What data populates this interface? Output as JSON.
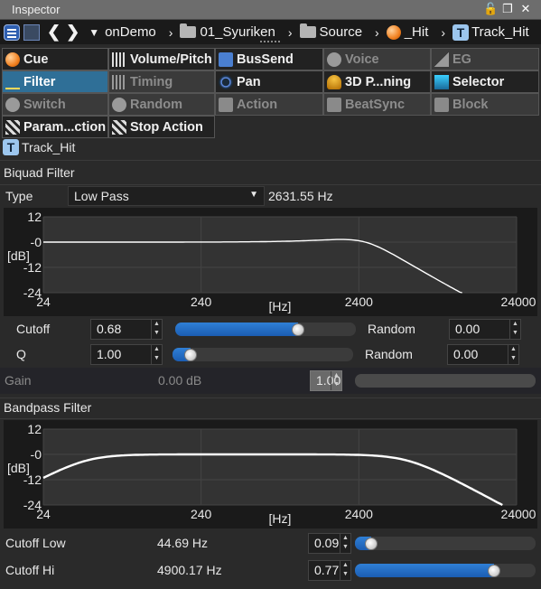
{
  "window": {
    "title": "Inspector"
  },
  "breadcrumb": [
    {
      "label": "onDemo",
      "icon": "dropdown-arrow"
    },
    {
      "label": "01_Syuriken",
      "icon": "folder-icon"
    },
    {
      "label": "Source",
      "icon": "folder-icon"
    },
    {
      "label": "_Hit",
      "icon": "cue-orb-icon"
    },
    {
      "label": "Track_Hit",
      "icon": "track-icon"
    }
  ],
  "modules": [
    {
      "label": "Cue",
      "icon": "cue-orb-icon",
      "enabled": true,
      "selected": false
    },
    {
      "label": "Volume/Pitch",
      "icon": "volume-pitch-icon",
      "enabled": true,
      "selected": false
    },
    {
      "label": "BusSend",
      "icon": "bussend-icon",
      "enabled": true,
      "selected": false
    },
    {
      "label": "Voice",
      "icon": "voice-icon",
      "enabled": false,
      "selected": false
    },
    {
      "label": "EG",
      "icon": "eg-icon",
      "enabled": false,
      "selected": false
    },
    {
      "label": "Filter",
      "icon": "filter-icon",
      "enabled": true,
      "selected": true
    },
    {
      "label": "Timing",
      "icon": "timing-icon",
      "enabled": false,
      "selected": false
    },
    {
      "label": "Pan",
      "icon": "pan-icon",
      "enabled": true,
      "selected": false
    },
    {
      "label": "3D P...ning",
      "icon": "3d-panning-icon",
      "enabled": true,
      "selected": false
    },
    {
      "label": "Selector",
      "icon": "selector-icon",
      "enabled": true,
      "selected": false
    },
    {
      "label": "Switch",
      "icon": "switch-icon",
      "enabled": false,
      "selected": false
    },
    {
      "label": "Random",
      "icon": "random-icon",
      "enabled": false,
      "selected": false
    },
    {
      "label": "Action",
      "icon": "action-icon",
      "enabled": false,
      "selected": false
    },
    {
      "label": "BeatSync",
      "icon": "beatsync-icon",
      "enabled": false,
      "selected": false
    },
    {
      "label": "Block",
      "icon": "block-icon",
      "enabled": false,
      "selected": false
    },
    {
      "label": "Param...ction",
      "icon": "clapper-icon",
      "enabled": true,
      "selected": false
    },
    {
      "label": "Stop Action",
      "icon": "clapper-icon",
      "enabled": true,
      "selected": false
    }
  ],
  "track": {
    "label": "Track_Hit"
  },
  "biquad": {
    "title": "Biquad Filter",
    "type_label": "Type",
    "type_value": "Low Pass",
    "freq_readout": "2631.55 Hz",
    "y_ticks": [
      "12",
      "-0",
      "-12",
      "-24"
    ],
    "y_unit": "[dB]",
    "x_ticks": [
      "24",
      "240",
      "2400",
      "24000"
    ],
    "x_unit": "[Hz]",
    "cutoff_label": "Cutoff",
    "cutoff_value": "0.68",
    "cutoff_level": 0.68,
    "q_label": "Q",
    "q_value": "1.00",
    "q_level": 0.1,
    "random_label": "Random",
    "random_cutoff_value": "0.00",
    "random_q_value": "0.00",
    "gain_label": "Gain",
    "gain_db": "0.00 dB",
    "gain_value": "1.00"
  },
  "bandpass": {
    "title": "Bandpass Filter",
    "y_ticks": [
      "12",
      "-0",
      "-12",
      "-24"
    ],
    "y_unit": "[dB]",
    "x_ticks": [
      "24",
      "240",
      "2400",
      "24000"
    ],
    "x_unit": "[Hz]",
    "cutoff_low_label": "Cutoff Low",
    "cutoff_low_hz": "44.69 Hz",
    "cutoff_low_value": "0.09",
    "cutoff_low_level": 0.09,
    "cutoff_hi_label": "Cutoff Hi",
    "cutoff_hi_hz": "4900.17 Hz",
    "cutoff_hi_value": "0.77",
    "cutoff_hi_level": 0.77
  },
  "colors": {
    "selected": "#2f6f97",
    "accent": "#1b5db2",
    "curve": "#ffffff"
  }
}
